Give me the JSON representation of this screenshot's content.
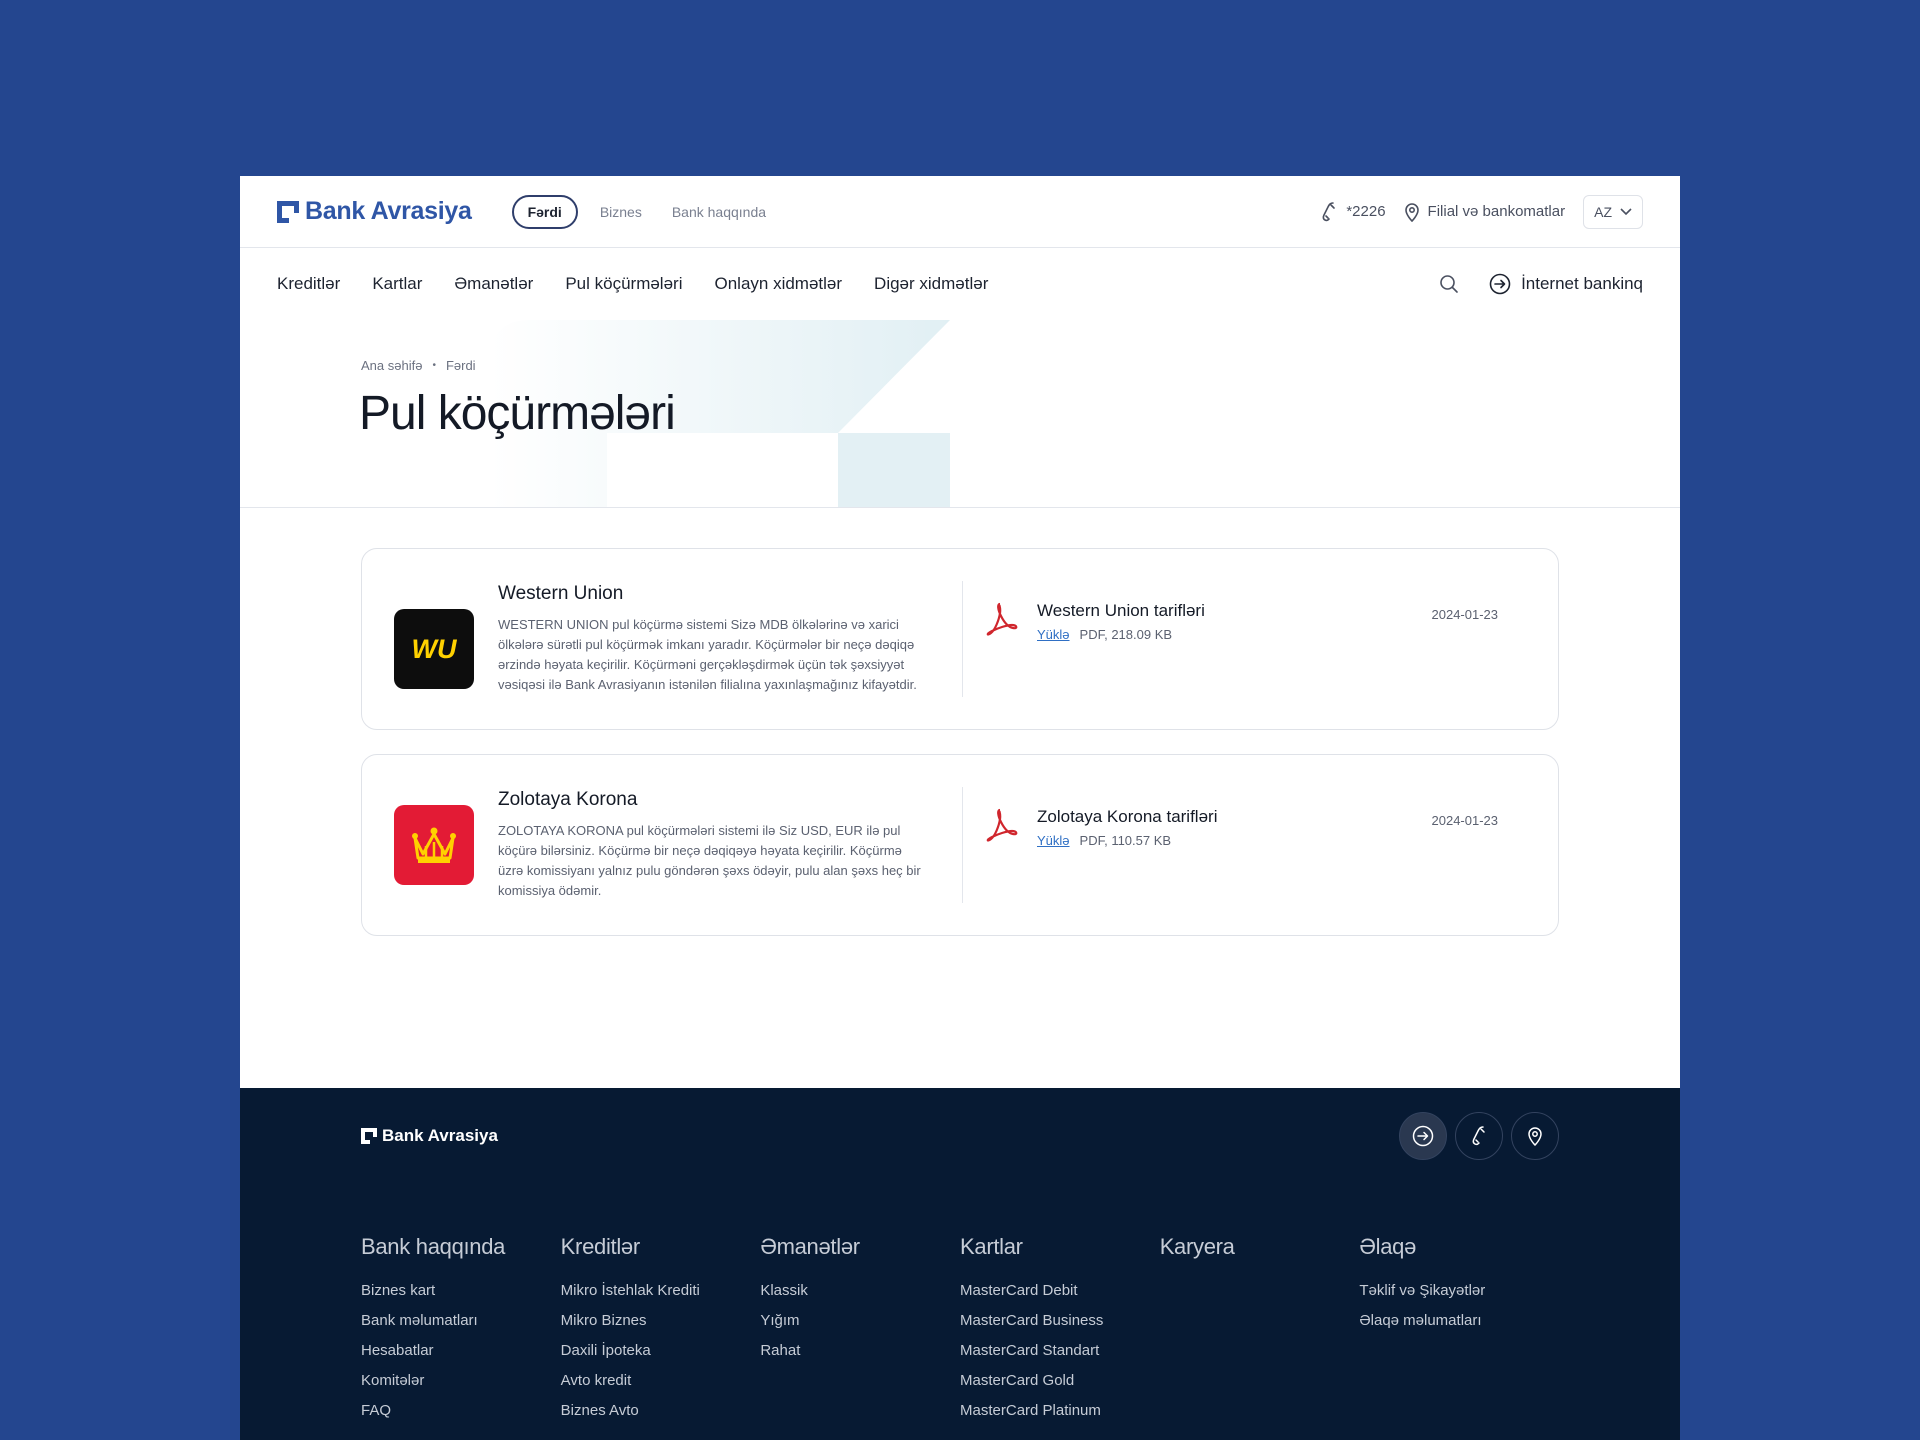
{
  "header": {
    "logo_text": "Bank Avrasiya",
    "segments": [
      "Fərdi",
      "Biznes",
      "Bank haqqında"
    ],
    "phone": "*2226",
    "branches": "Filial və bankomatlar",
    "lang": "AZ"
  },
  "nav": {
    "items": [
      "Kreditlər",
      "Kartlar",
      "Əmanətlər",
      "Pul köçürmələri",
      "Onlayn xidmətlər",
      "Digər xidmətlər"
    ],
    "internet_banking": "İnternet bankinq"
  },
  "hero": {
    "breadcrumb": [
      "Ana səhifə",
      "Fərdi"
    ],
    "title": "Pul köçürmələri"
  },
  "cards": [
    {
      "name": "Western Union",
      "logo_text": "WU",
      "logo_bg": "#0d0d0d",
      "description": "WESTERN UNION pul köçürmə sistemi Sizə MDB ölkələrinə və xarici ölkələrə sürətli pul köçürmək imkanı yaradır. Köçürmələr bir neçə dəqiqə ərzində həyata keçirilir. Köçürməni gerçəkləşdirmək üçün tək şəxsiyyət vəsiqəsi ilə Bank Avrasiyanın istənilən filialına yaxınlaşmağınız kifayətdir.",
      "doc_title": "Western Union tarifləri",
      "download": "Yüklə",
      "file_info": "PDF, 218.09 KB",
      "date": "2024-01-23"
    },
    {
      "name": "Zolotaya Korona",
      "logo_text": "",
      "logo_bg": "#e31b35",
      "description": "ZOLOTAYA KORONA pul köçürmələri sistemi ilə Siz USD, EUR ilə pul köçürə bilərsiniz. Köçürmə bir neçə dəqiqəyə həyata keçirilir. Köçürmə üzrə komissiyanı yalnız pulu göndərən şəxs ödəyir, pulu alan şəxs heç bir komissiya ödəmir.",
      "doc_title": "Zolotaya Korona tarifləri",
      "download": "Yüklə",
      "file_info": "PDF, 110.57 KB",
      "date": "2024-01-23"
    }
  ],
  "footer": {
    "logo_text": "Bank Avrasiya",
    "columns": [
      {
        "title": "Bank haqqında",
        "links": [
          "Biznes kart",
          "Bank məlumatları",
          "Hesabatlar",
          "Komitələr",
          "FAQ"
        ]
      },
      {
        "title": "Kreditlər",
        "links": [
          "Mikro İstehlak Krediti",
          "Mikro Biznes",
          "Daxili İpoteka",
          "Avto kredit",
          "Biznes Avto"
        ]
      },
      {
        "title": "Əmanətlər",
        "links": [
          "Klassik",
          "Yığım",
          "Rahat"
        ]
      },
      {
        "title": "Kartlar",
        "links": [
          "MasterCard Debit",
          "MasterCard Business",
          "MasterCard Standart",
          "MasterCard Gold",
          "MasterCard Platinum"
        ]
      },
      {
        "title": "Karyera",
        "links": []
      },
      {
        "title": "Əlaqə",
        "links": [
          "Təklif və Şikayətlər",
          "Əlaqə məlumatları"
        ]
      }
    ]
  },
  "colors": {
    "page_bg": "#24468f",
    "brand": "#2f56a6",
    "footer_bg": "#071a33",
    "pdf_red": "#d0262d",
    "link": "#2f6fc4"
  },
  "icons": [
    "phone-icon",
    "location-pin-icon",
    "chevron-down-icon",
    "search-icon",
    "login-arrow-icon",
    "pdf-icon",
    "crown-icon"
  ]
}
